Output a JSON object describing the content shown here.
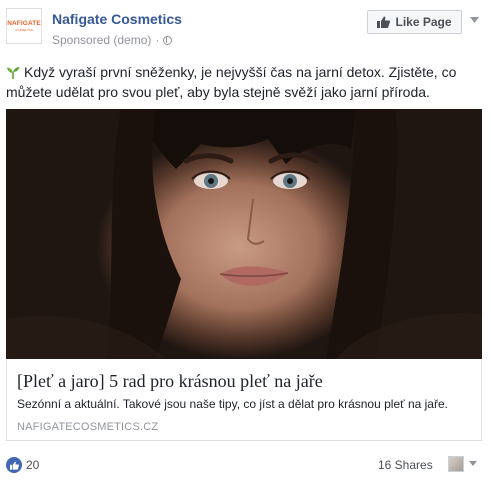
{
  "header": {
    "logo_word": "NAFIGATE",
    "logo_tagline": "COSMETICS",
    "page_name": "Nafigate Cosmetics",
    "sponsored": "Sponsored (demo)",
    "separator": "·",
    "like_page": "Like Page"
  },
  "post": {
    "text": "Když vyraší první sněženky, je nejvyšší čas na jarní detox. Zjistěte, co můžete udělat pro svou pleť, aby byla stejně svěží jako jarní příroda."
  },
  "link": {
    "title": "[Pleť a jaro] 5 rad pro krásnou pleť na jaře",
    "description": "Sezónní a aktuální. Takové jsou naše tipy, co jíst a dělat pro krásnou pleť na jaře.",
    "domain": "NAFIGATECOSMETICS.CZ"
  },
  "footer": {
    "reactions_count": "20",
    "shares": "16 Shares"
  },
  "colors": {
    "link_blue": "#365899",
    "like_blue": "#4267b2",
    "muted": "#90949c"
  }
}
